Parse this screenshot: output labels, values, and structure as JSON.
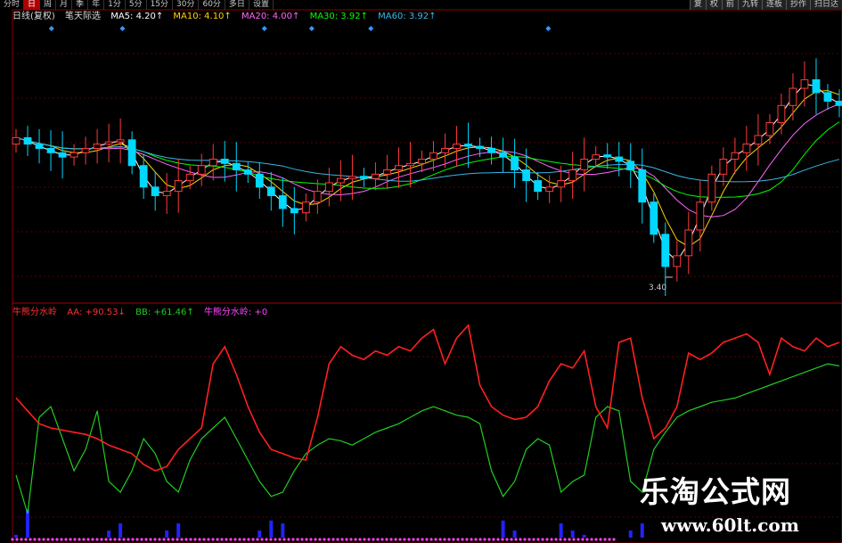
{
  "toolbar": {
    "left": [
      "分时",
      "日",
      "周",
      "月",
      "季",
      "年",
      "1分",
      "5分",
      "15分",
      "30分",
      "60分",
      "多日",
      "设置"
    ],
    "right": [
      "复",
      "权",
      "前",
      "九转",
      "连板",
      "抄作",
      "扫日达"
    ]
  },
  "price_legend": {
    "period": "日线(复权)",
    "indicator": "笔天际选",
    "ma5": "MA5: 4.20↑",
    "ma10": "MA10: 4.10↑",
    "ma20": "MA20: 4.00↑",
    "ma30": "MA30: 3.92↑",
    "ma60": "MA60: 3.92↑"
  },
  "low_label": "3.40",
  "indicator_legend": {
    "name": "牛熊分水岭",
    "aa": "AA: +90.53↓",
    "bb": "BB: +61.46↑",
    "name2": "牛熊分水岭: +0"
  },
  "watermark": {
    "title": "乐淘公式网",
    "url": "www.60lt.com"
  },
  "colors": {
    "up": "#ff3a3a",
    "down": "#00d8ff",
    "ma5": "#ffffff",
    "ma10": "#ffd400",
    "ma20": "#ff66ff",
    "ma30": "#00ff00",
    "ma60": "#3ab6e8",
    "aa": "#ff2020",
    "bb": "#22cc22",
    "bars": "#2222ff",
    "marker": "#3399ff"
  },
  "chart_data": [
    {
      "type": "candlestick",
      "series_names": [
        "MA5",
        "MA10",
        "MA20",
        "MA30",
        "MA60"
      ],
      "ylim": [
        3.3,
        4.6
      ],
      "y_low": 3.4,
      "closes": [
        4.05,
        4.02,
        4.0,
        3.98,
        3.96,
        3.98,
        4.0,
        4.02,
        4.03,
        4.04,
        3.92,
        3.82,
        3.78,
        3.8,
        3.85,
        3.88,
        3.92,
        3.95,
        3.93,
        3.9,
        3.88,
        3.82,
        3.78,
        3.72,
        3.7,
        3.75,
        3.8,
        3.84,
        3.86,
        3.87,
        3.86,
        3.88,
        3.9,
        3.92,
        3.93,
        3.95,
        3.98,
        4.0,
        4.02,
        4.01,
        4.0,
        3.98,
        3.96,
        3.9,
        3.85,
        3.8,
        3.82,
        3.85,
        3.9,
        3.95,
        3.97,
        3.96,
        3.94,
        3.9,
        3.75,
        3.6,
        3.45,
        3.5,
        3.62,
        3.75,
        3.88,
        3.95,
        3.98,
        4.02,
        4.06,
        4.12,
        4.2,
        4.28,
        4.32,
        4.26,
        4.22,
        4.2
      ]
    },
    {
      "type": "line",
      "series_names": [
        "AA",
        "BB"
      ],
      "ylim": [
        0,
        100
      ],
      "AA": [
        64,
        58,
        52,
        50,
        49,
        48,
        47,
        45,
        42,
        40,
        38,
        33,
        30,
        32,
        40,
        45,
        50,
        80,
        88,
        75,
        60,
        48,
        40,
        38,
        36,
        35,
        55,
        80,
        88,
        84,
        82,
        86,
        84,
        88,
        86,
        92,
        96,
        80,
        92,
        98,
        70,
        60,
        56,
        54,
        55,
        60,
        72,
        80,
        78,
        86,
        60,
        50,
        90,
        92,
        64,
        45,
        50,
        60,
        85,
        82,
        85,
        90,
        92,
        94,
        90,
        75,
        92,
        88,
        86,
        92,
        88,
        90
      ],
      "BB": [
        28,
        10,
        55,
        60,
        45,
        30,
        40,
        58,
        25,
        20,
        30,
        45,
        38,
        25,
        20,
        35,
        45,
        50,
        55,
        45,
        35,
        25,
        18,
        20,
        30,
        38,
        42,
        45,
        44,
        42,
        45,
        48,
        50,
        52,
        55,
        58,
        60,
        58,
        56,
        55,
        52,
        30,
        18,
        25,
        40,
        45,
        42,
        20,
        25,
        28,
        55,
        60,
        58,
        25,
        20,
        40,
        48,
        55,
        58,
        60,
        62,
        63,
        64,
        66,
        68,
        70,
        72,
        74,
        76,
        78,
        80,
        79
      ]
    }
  ]
}
